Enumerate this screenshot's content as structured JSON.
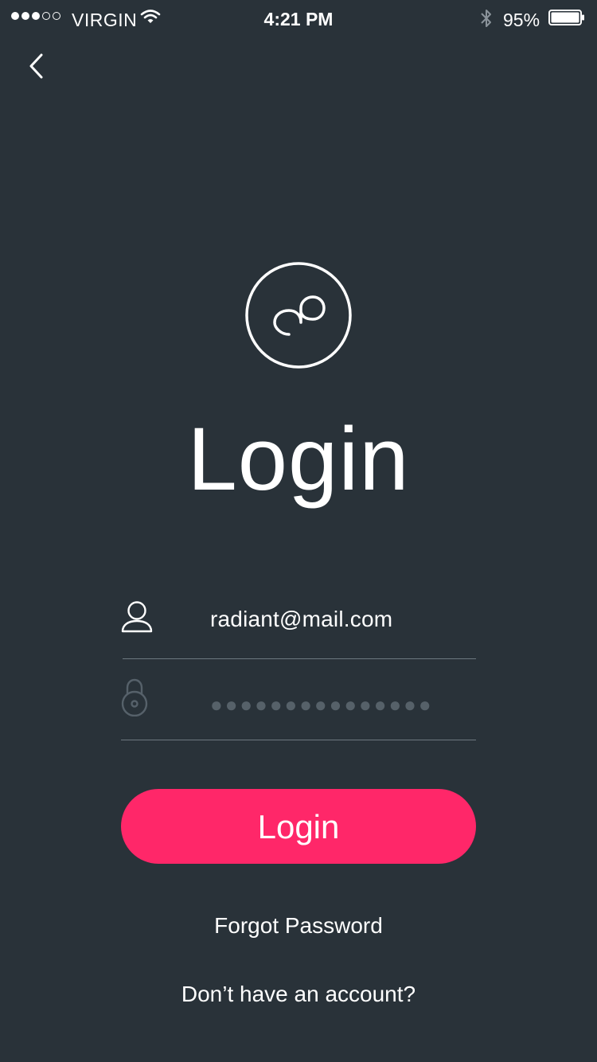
{
  "status_bar": {
    "carrier": "VIRGIN",
    "time": "4:21 PM",
    "battery": "95%"
  },
  "page": {
    "title": "Login"
  },
  "form": {
    "email_value": "radiant@mail.com",
    "password_value": "●●●●●●●●●●●●●●●"
  },
  "actions": {
    "login_label": "Login",
    "forgot_label": "Forgot Password",
    "signup_label": "Don’t have an account?"
  },
  "colors": {
    "background": "#293239",
    "accent": "#ff2769"
  },
  "icons": {
    "back": "chevron-left-icon",
    "logo": "infinity-loop-logo",
    "user": "user-icon",
    "lock": "lock-icon"
  }
}
